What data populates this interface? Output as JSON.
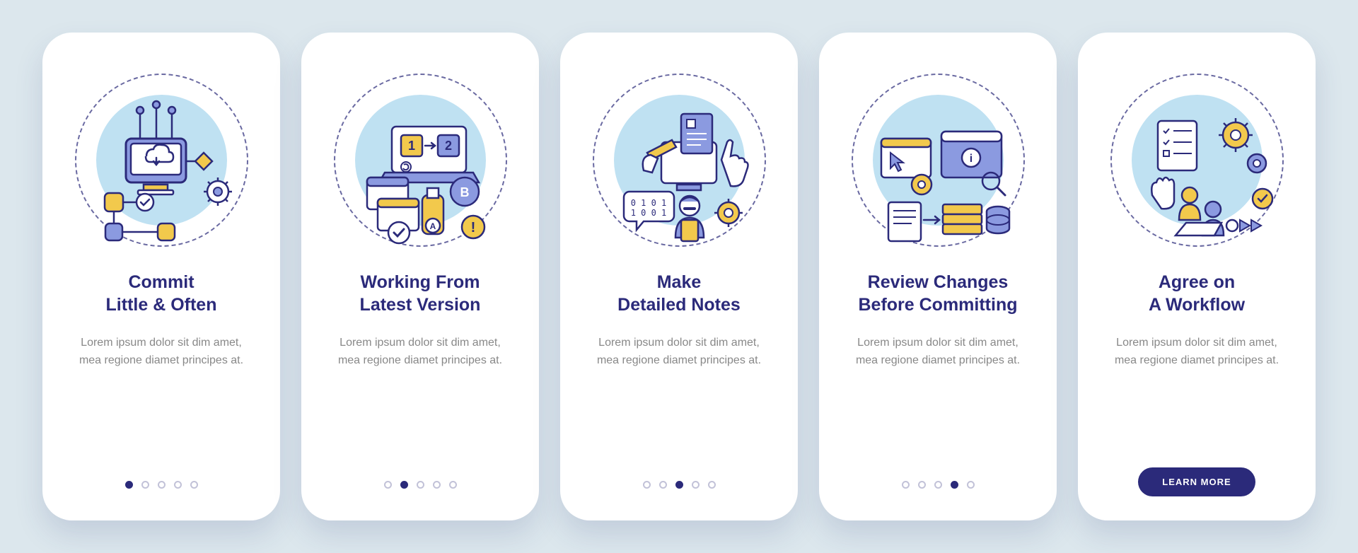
{
  "body_text": "Lorem ipsum dolor sit dim amet, mea regione diamet principes at.",
  "learn_more_label": "LEARN MORE",
  "colors": {
    "primary": "#2b2a7a",
    "accent_yellow": "#f2c94c",
    "accent_blue": "#8b9ae0",
    "light_blue": "#bfe1f2",
    "page_bg": "#dce7ed"
  },
  "cards": [
    {
      "title": "Commit\nLittle & Often",
      "icon": "commit-graph-icon",
      "active_dot": 0,
      "show_button": false
    },
    {
      "title": "Working From\nLatest Version",
      "icon": "version-windows-icon",
      "active_dot": 1,
      "show_button": false
    },
    {
      "title": "Make\nDetailed Notes",
      "icon": "notes-person-icon",
      "active_dot": 2,
      "show_button": false
    },
    {
      "title": "Review Changes\nBefore Committing",
      "icon": "review-data-icon",
      "active_dot": 3,
      "show_button": false
    },
    {
      "title": "Agree on\nA Workflow",
      "icon": "workflow-team-icon",
      "active_dot": 4,
      "show_button": true
    }
  ],
  "dots_total": 5
}
